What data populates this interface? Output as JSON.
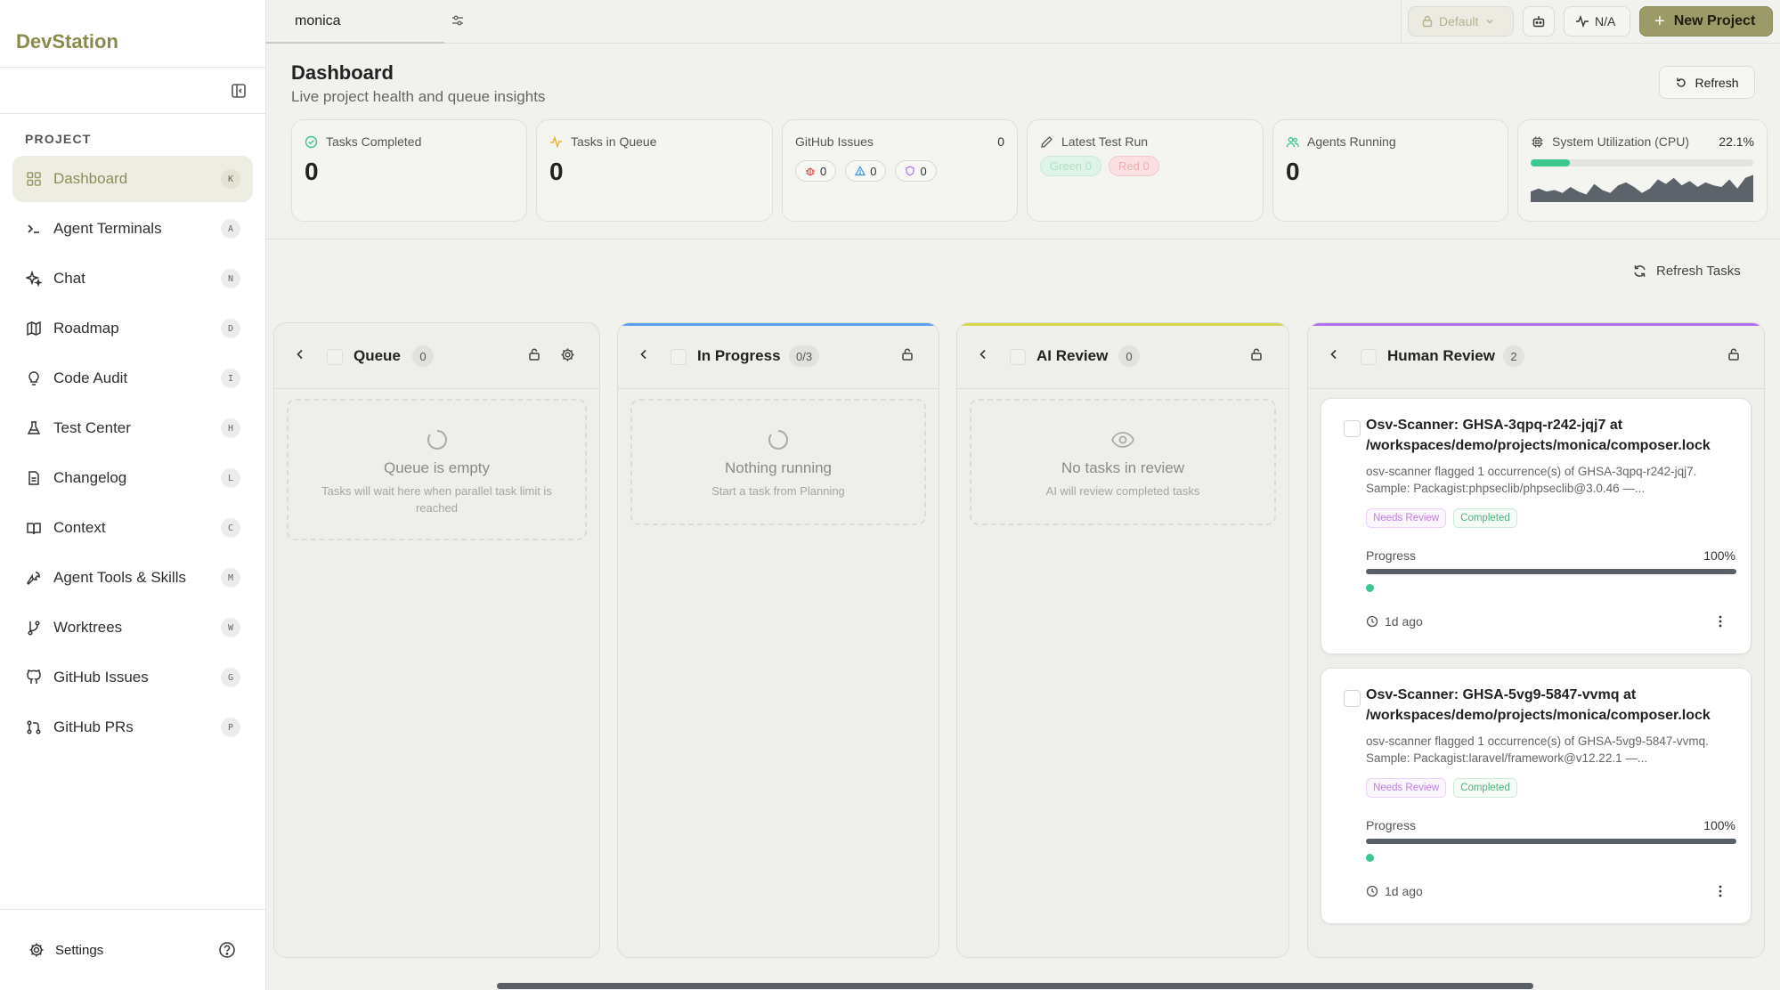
{
  "app": {
    "brand": "DevStation"
  },
  "sidebar": {
    "section_label": "PROJECT",
    "items": [
      {
        "label": "Dashboard",
        "key": "K",
        "icon": "grid-icon"
      },
      {
        "label": "Agent Terminals",
        "key": "A",
        "icon": "terminal-icon"
      },
      {
        "label": "Chat",
        "key": "N",
        "icon": "sparkles-icon"
      },
      {
        "label": "Roadmap",
        "key": "D",
        "icon": "map-icon"
      },
      {
        "label": "Code Audit",
        "key": "I",
        "icon": "lightbulb-icon"
      },
      {
        "label": "Test Center",
        "key": "H",
        "icon": "flask-icon"
      },
      {
        "label": "Changelog",
        "key": "L",
        "icon": "file-icon"
      },
      {
        "label": "Context",
        "key": "C",
        "icon": "book-icon"
      },
      {
        "label": "Agent Tools & Skills",
        "key": "M",
        "icon": "wrench-icon"
      },
      {
        "label": "Worktrees",
        "key": "W",
        "icon": "git-branch-icon"
      },
      {
        "label": "GitHub Issues",
        "key": "G",
        "icon": "github-icon"
      },
      {
        "label": "GitHub PRs",
        "key": "P",
        "icon": "git-pull-request-icon"
      }
    ],
    "settings_label": "Settings"
  },
  "topbar": {
    "project_tab": "monica",
    "profile_label": "Default",
    "status_label": "N/A",
    "new_project_label": "New Project"
  },
  "dashboard": {
    "title": "Dashboard",
    "subtitle": "Live project health and queue insights",
    "refresh_label": "Refresh",
    "refresh_tasks_label": "Refresh Tasks"
  },
  "stats": {
    "tasks_completed": {
      "label": "Tasks Completed",
      "value": "0"
    },
    "tasks_in_queue": {
      "label": "Tasks in Queue",
      "value": "0"
    },
    "github_issues": {
      "label": "GitHub Issues",
      "total": "0",
      "bugs": "0",
      "warnings": "0",
      "security": "0"
    },
    "latest_test_run": {
      "label": "Latest Test Run",
      "green": "Green 0",
      "red": "Red 0"
    },
    "agents_running": {
      "label": "Agents Running",
      "value": "0"
    },
    "cpu": {
      "label": "System Utilization (CPU)",
      "value": "22.1%",
      "fraction": 0.177,
      "history": [
        0.35,
        0.45,
        0.35,
        0.4,
        0.3,
        0.5,
        0.35,
        0.25,
        0.6,
        0.4,
        0.3,
        0.55,
        0.65,
        0.5,
        0.3,
        0.45,
        0.75,
        0.6,
        0.8,
        0.55,
        0.7,
        0.5,
        0.65,
        0.55,
        0.5,
        0.75,
        0.45,
        0.8,
        0.9
      ]
    }
  },
  "columns": {
    "queue": {
      "name": "Queue",
      "count": "0",
      "empty_title": "Queue is empty",
      "empty_sub": "Tasks will wait here when parallel task limit is reached"
    },
    "in_progress": {
      "name": "In Progress",
      "count": "0/3",
      "empty_title": "Nothing running",
      "empty_sub": "Start a task from Planning"
    },
    "ai_review": {
      "name": "AI Review",
      "count": "0",
      "empty_title": "No tasks in review",
      "empty_sub": "AI will review completed tasks"
    },
    "human_review": {
      "name": "Human Review",
      "count": "2",
      "tasks": [
        {
          "title": "Osv-Scanner: GHSA-3qpq-r242-jqj7 at /workspaces/demo/projects/monica/composer.lock",
          "description": "osv-scanner flagged 1 occurrence(s) of GHSA-3qpq-r242-jqj7. Sample: Packagist:phpseclib/phpseclib@3.0.46 —...",
          "tag_review": "Needs Review",
          "tag_status": "Completed",
          "progress_label": "Progress",
          "progress": "100%",
          "progress_fraction": 1.0,
          "time": "1d ago"
        },
        {
          "title": "Osv-Scanner: GHSA-5vg9-5847-vvmq at /workspaces/demo/projects/monica/composer.lock",
          "description": "osv-scanner flagged 1 occurrence(s) of GHSA-5vg9-5847-vvmq. Sample: Packagist:laravel/framework@v12.22.1 —...",
          "tag_review": "Needs Review",
          "tag_status": "Completed",
          "progress_label": "Progress",
          "progress": "100%",
          "progress_fraction": 1.0,
          "time": "1d ago"
        }
      ]
    }
  },
  "colors": {
    "accent": "#9b9a68",
    "brand": "#8a8a4a",
    "success": "#3cc88f",
    "in_progress": "#5b9ef0",
    "ai_review": "#d6d64a",
    "human_review": "#b06ff0"
  }
}
